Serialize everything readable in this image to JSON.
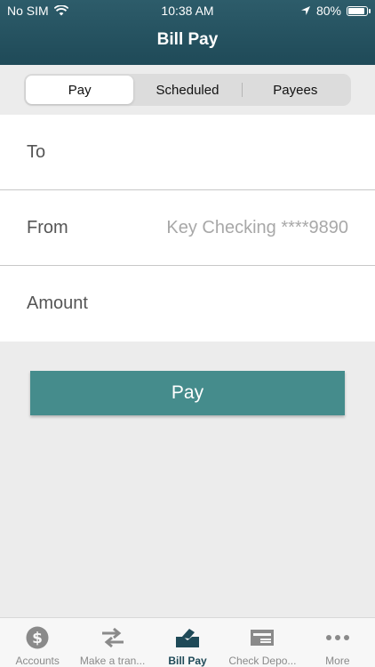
{
  "status_bar": {
    "carrier": "No SIM",
    "time": "10:38 AM",
    "battery": "80%"
  },
  "header": {
    "title": "Bill Pay"
  },
  "segments": [
    {
      "label": "Pay",
      "active": true
    },
    {
      "label": "Scheduled",
      "active": false
    },
    {
      "label": "Payees",
      "active": false
    }
  ],
  "form": {
    "to_label": "To",
    "to_value": "",
    "from_label": "From",
    "from_value": "Key Checking ****9890",
    "amount_label": "Amount",
    "amount_value": ""
  },
  "pay_button": "Pay",
  "tabbar": [
    {
      "label": "Accounts",
      "icon": "dollar-circle-icon",
      "active": false
    },
    {
      "label": "Make a tran...",
      "icon": "transfer-arrows-icon",
      "active": false
    },
    {
      "label": "Bill Pay",
      "icon": "bill-pay-icon",
      "active": true
    },
    {
      "label": "Check Depo...",
      "icon": "check-deposit-icon",
      "active": false
    },
    {
      "label": "More",
      "icon": "more-dots-icon",
      "active": false
    }
  ]
}
